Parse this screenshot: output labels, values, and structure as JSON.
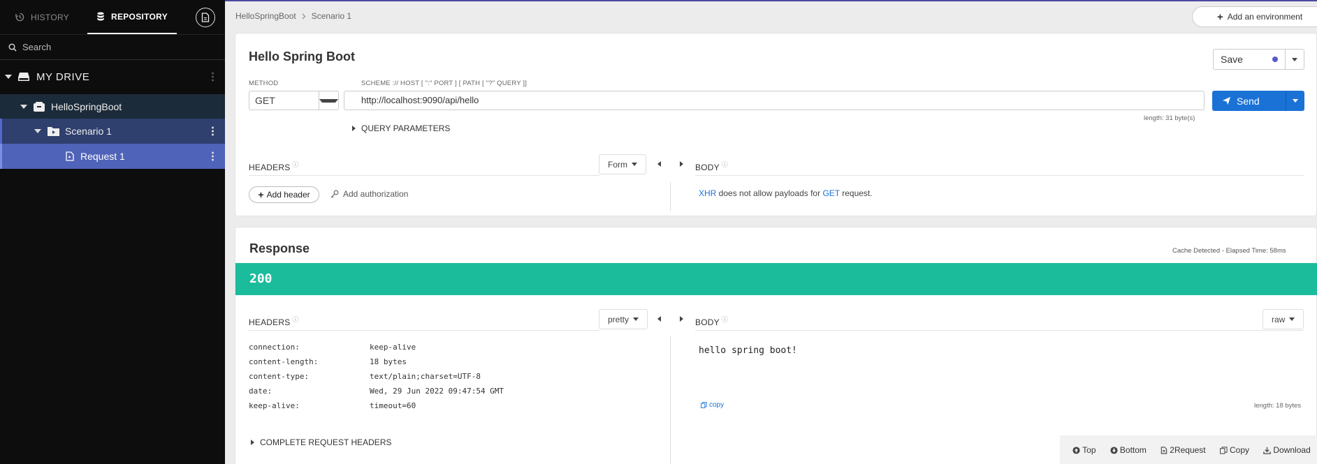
{
  "sidebar": {
    "tabs": {
      "history": "HISTORY",
      "repository": "REPOSITORY"
    },
    "search_placeholder": "Search",
    "tree": {
      "drive": "MY DRIVE",
      "project": "HelloSpringBoot",
      "scenario": "Scenario 1",
      "request": "Request 1"
    }
  },
  "breadcrumb": {
    "project": "HelloSpringBoot",
    "scenario": "Scenario 1"
  },
  "environment_button": "Add an environment",
  "request": {
    "title": "Hello Spring Boot",
    "save_label": "Save",
    "method_label": "METHOD",
    "method": "GET",
    "url_label": "SCHEME :// HOST [ \":\" PORT ] [ PATH [ \"?\" QUERY ]]",
    "url": "http://localhost:9090/api/hello",
    "send_label": "Send",
    "length": "length: 31 byte(s)",
    "query_params": "QUERY PARAMETERS",
    "headers_label": "HEADERS",
    "headers_mode": "Form",
    "body_label": "BODY",
    "add_header": "Add header",
    "add_auth": "Add authorization",
    "body_msg": {
      "xhr": "XHR",
      "mid": " does not allow payloads for ",
      "method": "GET",
      "end": " request."
    }
  },
  "response": {
    "title": "Response",
    "cache_info": "Cache Detected - Elapsed Time: 58ms",
    "status": "200",
    "headers_label": "HEADERS",
    "headers_mode": "pretty",
    "body_label": "BODY",
    "body_mode": "raw",
    "headers": [
      {
        "key": "connection:",
        "value": "keep-alive"
      },
      {
        "key": "content-length:",
        "value": "18 bytes"
      },
      {
        "key": "content-type:",
        "value": "text/plain;charset=UTF-8"
      },
      {
        "key": "date:",
        "value": "Wed, 29 Jun 2022 09:47:54 GMT"
      },
      {
        "key": "keep-alive:",
        "value": "timeout=60"
      }
    ],
    "body": "hello spring boot!",
    "copy_label": "copy",
    "length": "length: 18 bytes",
    "complete_headers": "COMPLETE REQUEST HEADERS",
    "actions": {
      "top": "Top",
      "bottom": "Bottom",
      "to_request": "2Request",
      "copy": "Copy",
      "download": "Download"
    }
  },
  "colors": {
    "status_ok": "#1abc9c",
    "primary": "#1a72d6",
    "sidebar_bg": "#0d0d0d"
  }
}
